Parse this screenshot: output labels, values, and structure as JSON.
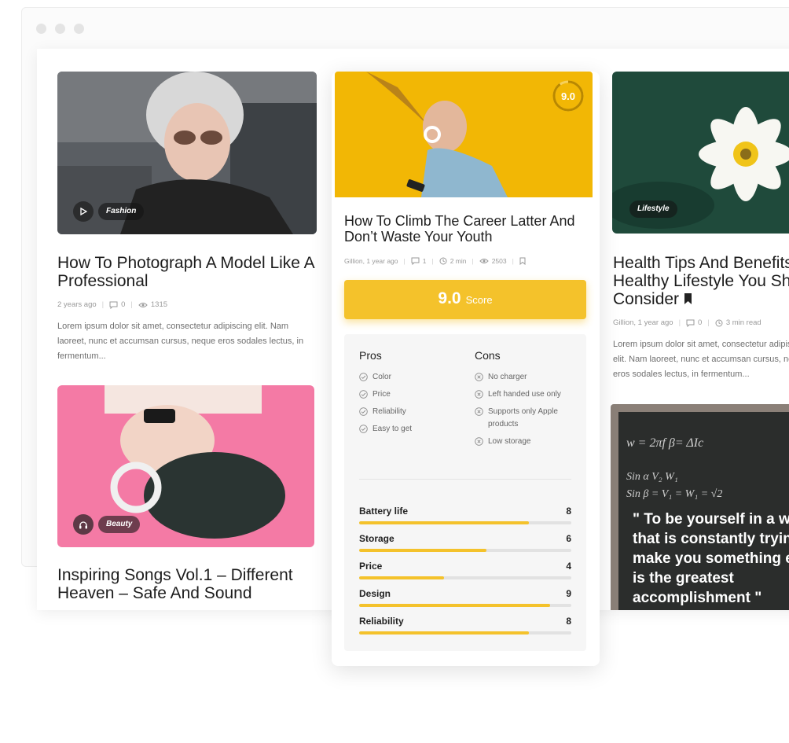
{
  "cards": [
    {
      "category": "Fashion",
      "title": "How To Photograph A Model Like A Professional",
      "date": "2 years ago",
      "comments": "0",
      "views": "1315",
      "excerpt": "Lorem ipsum dolor sit amet, consectetur adipiscing elit. Nam laoreet, nunc et accumsan cursus, neque eros sodales lectus, in fermentum..."
    },
    {
      "category": "Beauty",
      "title": "Inspiring Songs Vol.1 – Different Heaven – Safe And Sound"
    },
    {
      "category": "Lifestyle",
      "title": "Health Tips And Benefits Of Healthy Lifestyle You Should Consider",
      "author_date": "Gillion, 1 year ago",
      "comments": "0",
      "read_time": "3 min read",
      "excerpt": "Lorem ipsum dolor sit amet, consectetur adipiscing elit. Nam laoreet, nunc et accumsan cursus, neque eros sodales lectus, in fermentum..."
    }
  ],
  "quote": {
    "text": "\" To be yourself in a world that is constantly trying to make you something else is the greatest accomplishment \""
  },
  "review": {
    "score_ring": "9.0",
    "title": "How To Climb The Career Latter And Don’t Waste Your Youth",
    "author_date": "Gillion, 1 year ago",
    "comments": "1",
    "read_time": "2 min",
    "views": "2503",
    "score_value": "9.0",
    "score_label": "Score",
    "pros_heading": "Pros",
    "cons_heading": "Cons",
    "pros": [
      "Color",
      "Price",
      "Reliability",
      "Easy to get"
    ],
    "cons": [
      "No charger",
      "Left handed use only",
      "Supports only Apple products",
      "Low storage"
    ],
    "ratings": [
      {
        "label": "Battery life",
        "value": "8",
        "fraction": 0.8
      },
      {
        "label": "Storage",
        "value": "6",
        "fraction": 0.6
      },
      {
        "label": "Price",
        "value": "4",
        "fraction": 0.4
      },
      {
        "label": "Design",
        "value": "9",
        "fraction": 0.9
      },
      {
        "label": "Reliability",
        "value": "8",
        "fraction": 0.8
      }
    ]
  },
  "colors": {
    "accent": "#f4c22b",
    "pink": "#f47aa5",
    "chalkboard": "#2b2d2c"
  }
}
